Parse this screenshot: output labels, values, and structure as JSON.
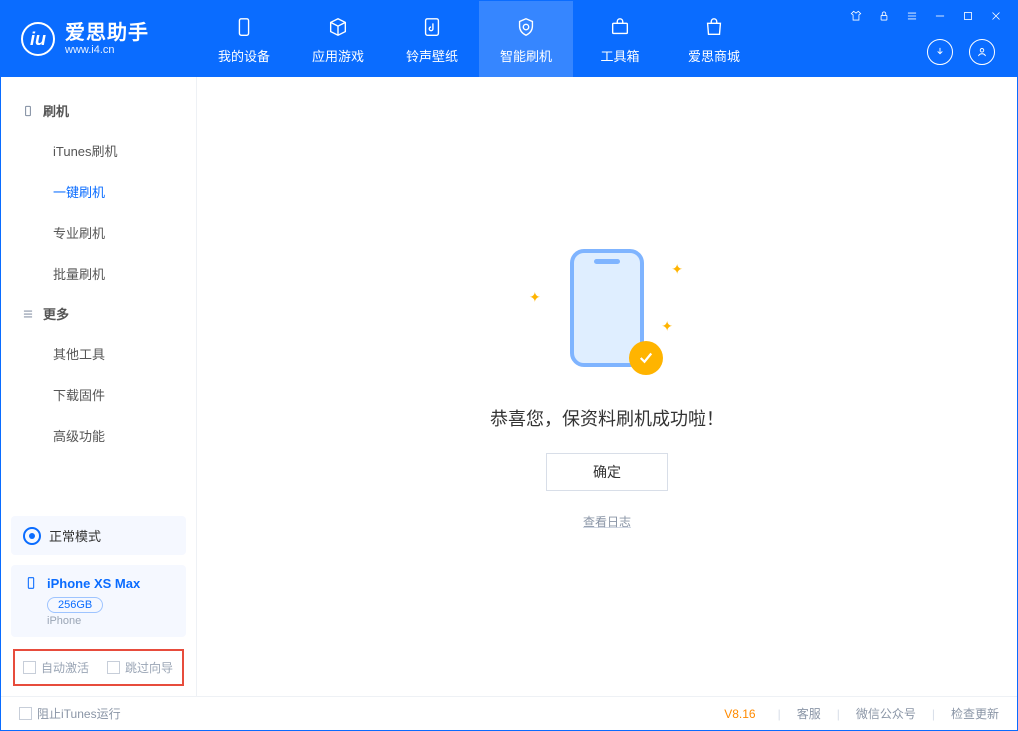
{
  "brand": {
    "title": "爱思助手",
    "subtitle": "www.i4.cn"
  },
  "tabs": {
    "device": "我的设备",
    "apps": "应用游戏",
    "ring": "铃声壁纸",
    "flash": "智能刷机",
    "toolbox": "工具箱",
    "store": "爱思商城"
  },
  "sidebar": {
    "group_flash": "刷机",
    "items_flash": {
      "itunes": "iTunes刷机",
      "oneclick": "一键刷机",
      "pro": "专业刷机",
      "batch": "批量刷机"
    },
    "group_more": "更多",
    "items_more": {
      "other": "其他工具",
      "firmware": "下载固件",
      "advanced": "高级功能"
    },
    "status_mode": "正常模式",
    "device": {
      "name": "iPhone XS Max",
      "capacity": "256GB",
      "type": "iPhone"
    },
    "opts": {
      "auto_activate": "自动激活",
      "skip_guide": "跳过向导"
    }
  },
  "main": {
    "message": "恭喜您，保资料刷机成功啦！",
    "ok": "确定",
    "view_log": "查看日志"
  },
  "footer": {
    "block_itunes": "阻止iTunes运行",
    "version": "V8.16",
    "support": "客服",
    "wechat": "微信公众号",
    "update": "检查更新"
  }
}
